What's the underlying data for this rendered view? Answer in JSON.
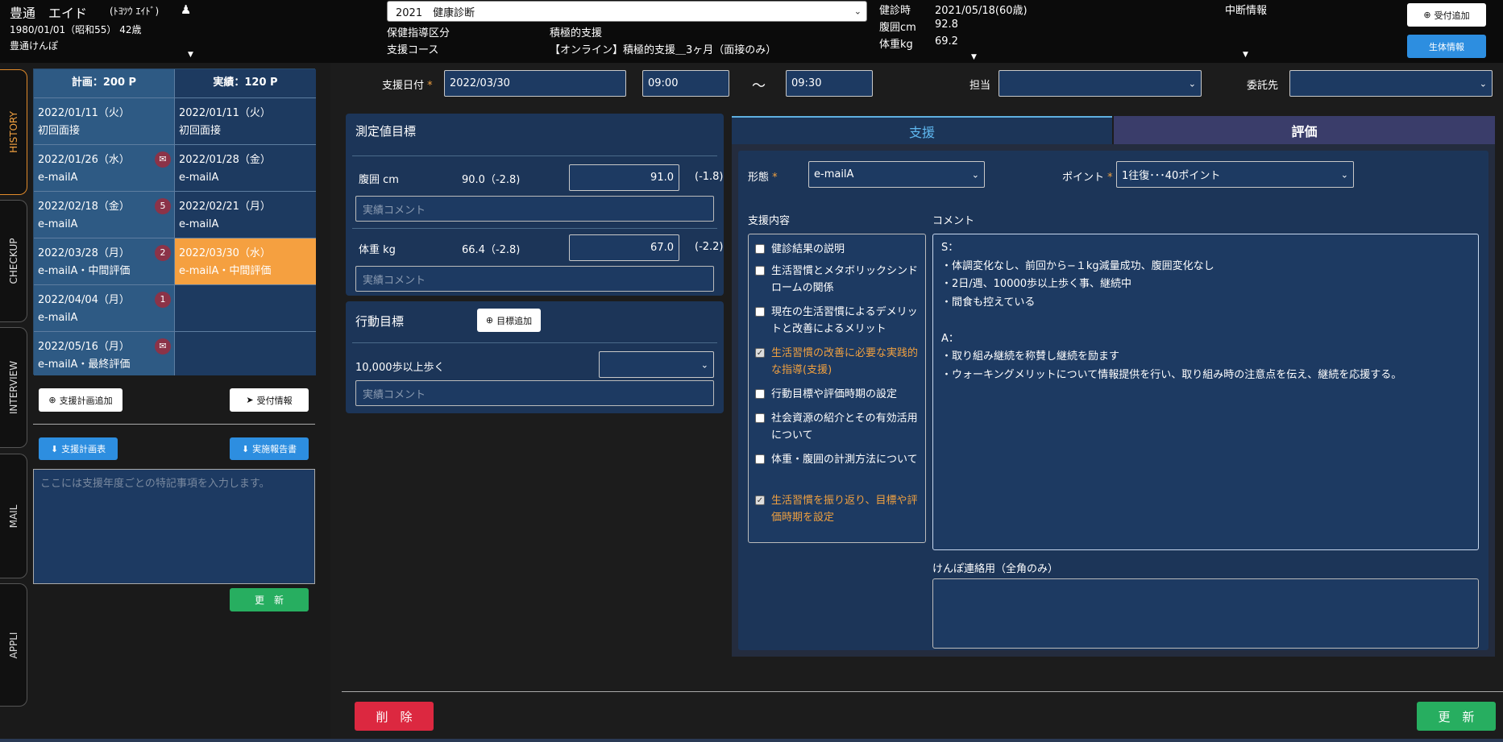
{
  "header": {
    "name": "豊通　エイド",
    "kana": "(ﾄﾖﾂｳ ｴｲﾄﾞ)",
    "birth": "1980/01/01（昭和55） 42歳",
    "insurer": "豊通けんぽ",
    "exam_select": "2021　健康診断",
    "guidance_label": "保健指導区分",
    "guidance_value": "積極的支援",
    "course_label": "支援コース",
    "course_value": "【オンライン】積極的支援＿3ヶ月（面接のみ）",
    "checkup_label": "健診時",
    "checkup_value": "2021/05/18(60歳)",
    "waist_label": "腹囲cm",
    "waist_value": "92.8",
    "weight_label": "体重kg",
    "weight_value": "69.2",
    "suspend_label": "中断情報",
    "reception_add_btn": "受付追加",
    "body_info_btn": "生体情報"
  },
  "side_tabs": [
    "HISTORY",
    "CHECKUP",
    "INTERVIEW",
    "MAIL",
    "APPLI"
  ],
  "plan": {
    "header_plan": "計画：200 P",
    "header_actual": "実績：120 P",
    "rows": [
      {
        "plan_date": "2022/01/11（火）",
        "plan_type": "初回面接",
        "badge": "",
        "actual_date": "2022/01/11（火）",
        "actual_type": "初回面接"
      },
      {
        "plan_date": "2022/01/26（水）",
        "plan_type": "e-mailA",
        "badge": "✉",
        "actual_date": "2022/01/28（金）",
        "actual_type": "e-mailA"
      },
      {
        "plan_date": "2022/02/18（金）",
        "plan_type": "e-mailA",
        "badge": "5",
        "actual_date": "2022/02/21（月）",
        "actual_type": "e-mailA"
      },
      {
        "plan_date": "2022/03/28（月）",
        "plan_type": "e-mailA・中間評価",
        "badge": "2",
        "actual_date": "2022/03/30（水）",
        "actual_type": "e-mailA・中間評価"
      },
      {
        "plan_date": "2022/04/04（月）",
        "plan_type": "e-mailA",
        "badge": "1",
        "actual_date": "",
        "actual_type": ""
      },
      {
        "plan_date": "2022/05/16（月）",
        "plan_type": "e-mailA・最終評価",
        "badge": "✉",
        "actual_date": "",
        "actual_type": ""
      }
    ],
    "add_plan_btn": "支援計画追加",
    "reception_btn": "受付情報",
    "plan_table_btn": "支援計画表",
    "report_btn": "実施報告書",
    "notes_placeholder": "ここには支援年度ごとの特記事項を入力します。",
    "update_btn": "更　新"
  },
  "form": {
    "date_label": "支援日付",
    "date_value": "2022/03/30",
    "time_from": "09:00",
    "tilde": "〜",
    "time_to": "09:30",
    "staff_label": "担当",
    "consign_label": "委託先"
  },
  "measure": {
    "title": "測定値目標",
    "waist_label": "腹囲 cm",
    "waist_target": "90.0（-2.8)",
    "waist_value": "91.0",
    "waist_diff": "(-1.8)",
    "weight_label": "体重 kg",
    "weight_target": "66.4（-2.8)",
    "weight_value": "67.0",
    "weight_diff": "(-2.2)",
    "comment_placeholder": "実績コメント"
  },
  "action": {
    "title": "行動目標",
    "add_btn": "目標追加",
    "goal_label": "10,000歩以上歩く",
    "comment_placeholder": "実績コメント"
  },
  "tabs": {
    "support": "支援",
    "eval": "評価"
  },
  "support": {
    "type_label": "形態",
    "type_value": "e-mailA",
    "point_label": "ポイント",
    "point_value": "1往復･･･40ポイント",
    "content_label": "支援内容",
    "comment_label": "コメント",
    "items": [
      {
        "text": "健診結果の説明",
        "checked": false
      },
      {
        "text": "生活習慣とメタボリックシンドロームの関係",
        "checked": false
      },
      {
        "text": "現在の生活習慣によるデメリットと改善によるメリット",
        "checked": false
      },
      {
        "text": "生活習慣の改善に必要な実践的な指導(支援)",
        "checked": true
      },
      {
        "text": "行動目標や評価時期の設定",
        "checked": false
      },
      {
        "text": "社会資源の紹介とその有効活用について",
        "checked": false
      },
      {
        "text": "体重・腹囲の計測方法について",
        "checked": false
      },
      {
        "text": "生活習慣を振り返り、目標や評価時期を設定",
        "checked": true
      }
    ],
    "comment_lines": [
      "S：",
      "・体調変化なし、前回から−１kg減量成功、腹囲変化なし",
      "・2日/週、10000歩以上歩く事、継続中",
      "・間食も控えている",
      "",
      "A：",
      "・取り組み継続を称賛し継続を励ます",
      "・ウォーキングメリットについて情報提供を行い、取り組み時の注意点を伝え、継続を応援する。"
    ],
    "kenpo_label": "けんぽ連絡用（全角のみ）"
  },
  "footer": {
    "delete_btn": "削　除",
    "update_btn": "更　新"
  }
}
